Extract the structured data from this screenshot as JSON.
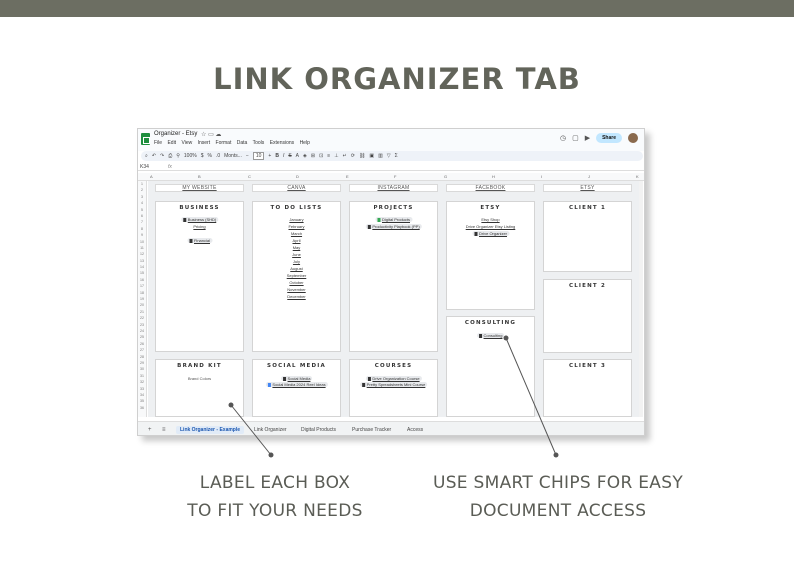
{
  "header_title": "LINK ORGANIZER TAB",
  "captions": {
    "left": [
      "LABEL EACH BOX",
      "TO FIT YOUR NEEDS"
    ],
    "right": [
      "USE SMART CHIPS FOR EASY",
      "DOCUMENT ACCESS"
    ]
  },
  "app": {
    "doc_title": "Organizer - Etsy",
    "menus": [
      "File",
      "Edit",
      "View",
      "Insert",
      "Format",
      "Data",
      "Tools",
      "Extensions",
      "Help"
    ],
    "share_label": "Share",
    "zoom": "100%",
    "font": "Monts...",
    "font_size": "10",
    "cell_ref": "K34",
    "columns": [
      "A",
      "B",
      "C",
      "D",
      "E",
      "F",
      "G",
      "H",
      "I",
      "J",
      "K"
    ]
  },
  "column_headers": [
    "MY WEBSITE",
    "CANVA",
    "INSTAGRAM",
    "FACEBOOK",
    "ETSY"
  ],
  "boxes": {
    "business": {
      "title": "BUSINESS",
      "chips": [
        "Business (SHD)",
        "Financial"
      ],
      "links": [
        "Pricing"
      ]
    },
    "todo": {
      "title": "TO DO LISTS",
      "links": [
        "January",
        "February",
        "March",
        "April",
        "May",
        "June",
        "July",
        "August",
        "September",
        "October",
        "November",
        "December"
      ]
    },
    "projects": {
      "title": "PROJECTS",
      "chips": [
        "Digital Products",
        "Productivity Playbook (PP)"
      ]
    },
    "etsy": {
      "title": "ETSY",
      "links": [
        "Etsy Shop",
        "Drive Organizer Etsy Listing"
      ],
      "chips": [
        "Drive Organizer"
      ]
    },
    "client1": {
      "title": "CLIENT 1"
    },
    "client2": {
      "title": "CLIENT 2"
    },
    "consulting": {
      "title": "CONSULTING",
      "chips": [
        "Consulting"
      ]
    },
    "brandkit": {
      "title": "BRAND KIT",
      "text": "Brand Colors"
    },
    "social": {
      "title": "SOCIAL MEDIA",
      "chips": [
        "Social Media",
        "Social Media 2024 Reel Ideas"
      ]
    },
    "courses": {
      "title": "COURSES",
      "chips": [
        "Drive Organization Course",
        "Pretty Spreadsheets Mini Course"
      ]
    },
    "client3": {
      "title": "CLIENT 3"
    }
  },
  "tabs": [
    "Link Organizer - Example",
    "Link Organizer",
    "Digital Products",
    "Purchase Tracker",
    "Access"
  ],
  "row_numbers": [
    "1",
    "2",
    "3",
    "4",
    "5",
    "6",
    "7",
    "8",
    "9",
    "10",
    "11",
    "12",
    "13",
    "14",
    "15",
    "16",
    "17",
    "18",
    "19",
    "20",
    "21",
    "22",
    "23",
    "24",
    "25",
    "26",
    "27",
    "28",
    "29",
    "30",
    "31",
    "32",
    "33",
    "34",
    "35",
    "36"
  ]
}
